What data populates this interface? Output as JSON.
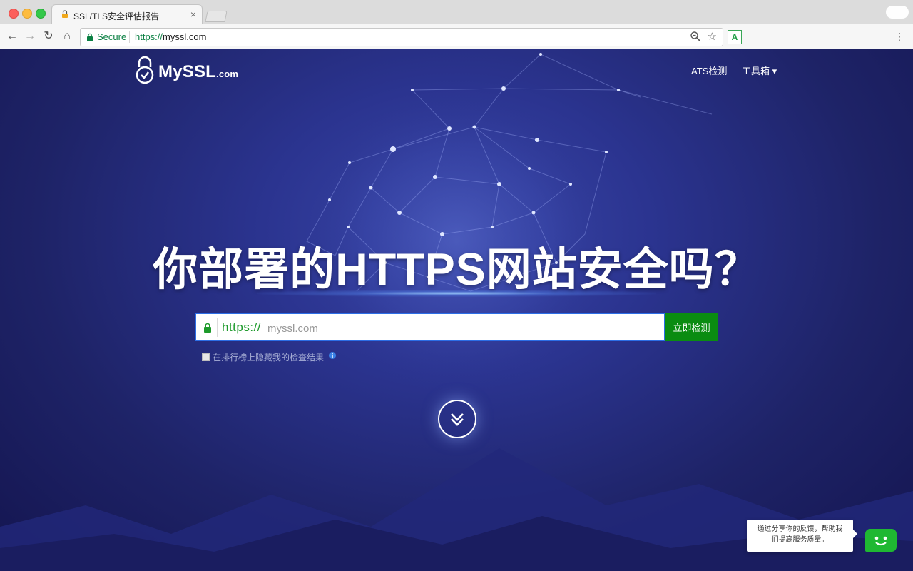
{
  "browser": {
    "tab_title": "SSL/TLS安全评估报告",
    "tab_close": "×",
    "secure_label": "Secure",
    "url_scheme": "https://",
    "url_host": "myssl.com"
  },
  "site": {
    "logo_main": "MySSL",
    "logo_suffix": ".com",
    "nav": {
      "ats": "ATS检测",
      "tools": "工具箱 ▾"
    },
    "hero_title": "你部署的HTTPS网站安全吗？",
    "search": {
      "scheme": "https://",
      "placeholder": "myssl.com",
      "button": "立即检测"
    },
    "hide_rank_label": "在排行榜上隐藏我的检查结果",
    "feedback_text_line1": "通过分享你的反馈，帮助我",
    "feedback_text_line2": "们提高服务质量。"
  },
  "colors": {
    "accent_green": "#0a8c11",
    "input_border": "#2c6ee6",
    "background": "#1c1f63"
  }
}
